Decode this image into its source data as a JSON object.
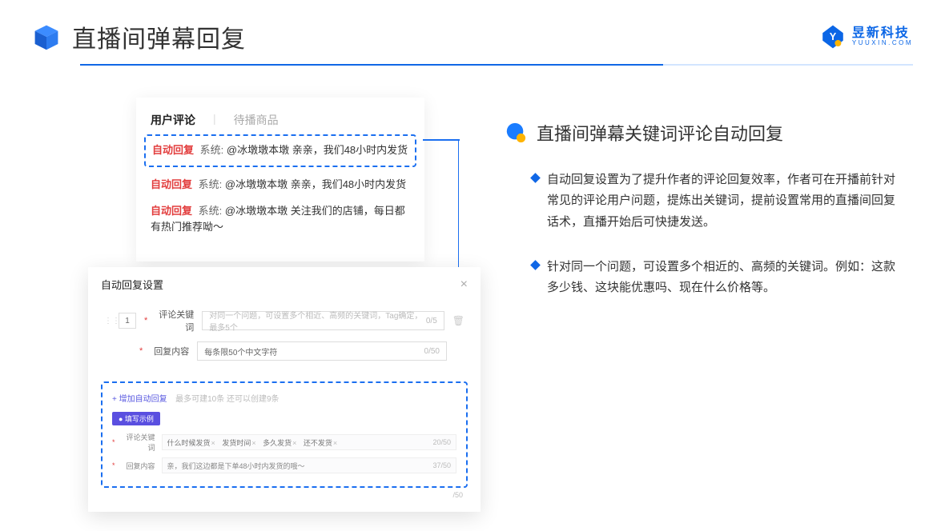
{
  "header": {
    "title": "直播间弹幕回复",
    "brand_cn": "昱新科技",
    "brand_en": "YUUXIN.COM"
  },
  "comments": {
    "tab_active": "用户评论",
    "tab_inactive": "待播商品",
    "items": [
      {
        "tag": "自动回复",
        "sys": "系统:",
        "text": "@冰墩墩本墩 亲亲，我们48小时内发货"
      },
      {
        "tag": "自动回复",
        "sys": "系统:",
        "text": "@冰墩墩本墩 亲亲，我们48小时内发货"
      },
      {
        "tag": "自动回复",
        "sys": "系统:",
        "text": "@冰墩墩本墩 关注我们的店铺，每日都有热门推荐呦～"
      }
    ]
  },
  "modal": {
    "title": "自动回复设置",
    "seq": "1",
    "kw_label": "评论关键词",
    "kw_placeholder": "对同一个问题，可设置多个相近、高频的关键词，Tag确定，最多5个",
    "kw_counter": "0/5",
    "reply_label": "回复内容",
    "reply_placeholder": "每条限50个中文字符",
    "reply_counter": "0/50",
    "add_link": "+ 增加自动回复",
    "add_tip": "最多可建10条 还可以创建9条",
    "example_badge": "● 填写示例",
    "ex_kw_label": "评论关键词",
    "ex_kw_tags": [
      "什么时候发货",
      "发货时间",
      "多久发货",
      "还不发货"
    ],
    "ex_kw_counter": "20/50",
    "ex_reply_label": "回复内容",
    "ex_reply_text": "亲，我们这边都是下单48小时内发货的哦～",
    "ex_reply_counter": "37/50",
    "outer_counter": "/50"
  },
  "section": {
    "title": "直播间弹幕关键词评论自动回复",
    "bullets": [
      "自动回复设置为了提升作者的评论回复效率，作者可在开播前针对常见的评论用户问题，提炼出关键词，提前设置常用的直播间回复话术，直播开始后可快捷发送。",
      "针对同一个问题，可设置多个相近的、高频的关键词。例如：这款多少钱、这块能优惠吗、现在什么价格等。"
    ]
  }
}
